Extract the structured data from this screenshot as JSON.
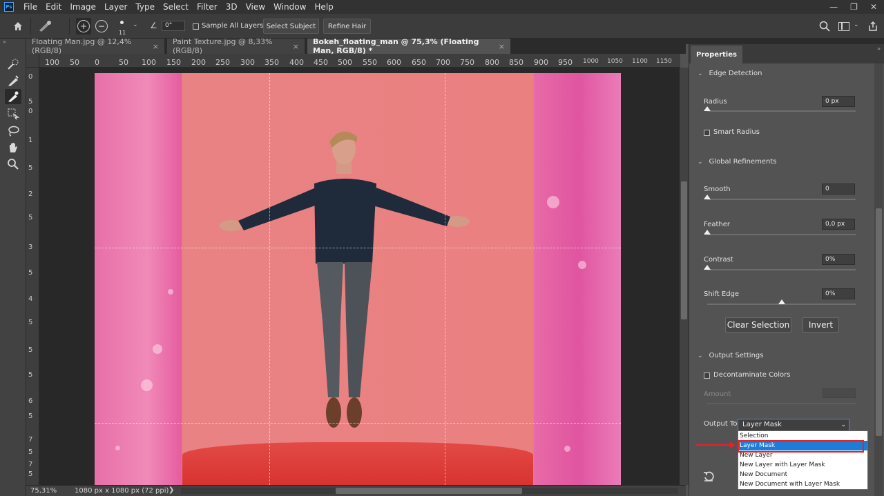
{
  "menubar": {
    "logo": "Ps",
    "items": [
      "File",
      "Edit",
      "Image",
      "Layer",
      "Type",
      "Select",
      "Filter",
      "3D",
      "View",
      "Window",
      "Help"
    ],
    "window_controls": [
      "—",
      "❐",
      "✕"
    ]
  },
  "options": {
    "brush_size": "11",
    "angle": "0°",
    "sample_all_layers": "Sample All Layers",
    "select_subject": "Select Subject",
    "refine_hair": "Refine Hair"
  },
  "tabs": [
    {
      "label": "Floating Man.jpg @ 12,4% (RGB/8)",
      "active": false
    },
    {
      "label": "Paint Texture.jpg @ 8,33% (RGB/8)",
      "active": false
    },
    {
      "label": "Bokeh_floating_man @ 75,3% (Floating Man, RGB/8) *",
      "active": true
    }
  ],
  "tab_close": "×",
  "ruler": {
    "top": [
      "100",
      "50",
      "0",
      "50",
      "100",
      "150",
      "200",
      "250",
      "300",
      "350",
      "400",
      "450",
      "500",
      "550",
      "600",
      "650",
      "700",
      "750",
      "800",
      "850",
      "900",
      "950",
      "1000",
      "1050",
      "1100",
      "1150"
    ],
    "left": [
      "0",
      "5",
      "0",
      "1",
      "5",
      "2",
      "5",
      "3",
      "5",
      "4",
      "5",
      "5",
      "5",
      "6",
      "5",
      "7",
      "5",
      "7",
      "5",
      "8"
    ]
  },
  "status": {
    "zoom": "75,31%",
    "doc_info": "1080 px x 1080 px (72 ppi)",
    "arrow": "❯"
  },
  "panel": {
    "tab": "Properties",
    "edge_detection": {
      "title": "Edge Detection",
      "radius_label": "Radius",
      "radius_value": "0 px",
      "smart_radius": "Smart Radius"
    },
    "global_refinements": {
      "title": "Global Refinements",
      "smooth_label": "Smooth",
      "smooth_value": "0",
      "feather_label": "Feather",
      "feather_value": "0,0 px",
      "contrast_label": "Contrast",
      "contrast_value": "0%",
      "shift_edge_label": "Shift Edge",
      "shift_edge_value": "0%",
      "shift_edge_level": 0.5
    },
    "clear_selection": "Clear Selection",
    "invert": "Invert",
    "output_settings": {
      "title": "Output Settings",
      "decontaminate": "Decontaminate Colors",
      "amount_label": "Amount",
      "output_to_label": "Output To",
      "output_to_value": "Layer Mask",
      "options": [
        "Selection",
        "Layer Mask",
        "New Layer",
        "New Layer with Layer Mask",
        "New Document",
        "New Document with Layer Mask"
      ],
      "highlighted_index": 1
    }
  },
  "colors": {
    "highlight_box": "#e2232a",
    "dropdown_highlight": "#1e7bd6"
  }
}
